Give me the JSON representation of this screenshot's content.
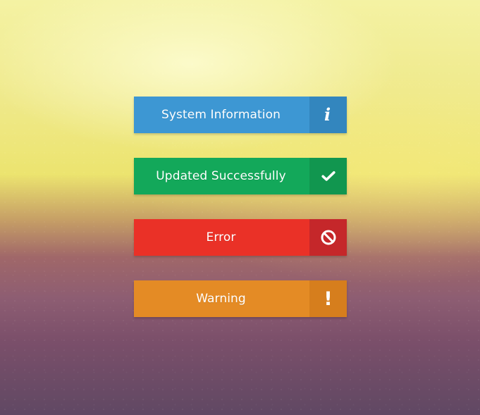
{
  "alerts": [
    {
      "label": "System Information",
      "icon": "info-icon",
      "icon_text": "i",
      "colors": {
        "main": "#3d97d3",
        "icon_bg": "#3386be"
      }
    },
    {
      "label": "Updated Successfully",
      "icon": "checkmark-icon",
      "colors": {
        "main": "#13a85a",
        "icon_bg": "#11964f"
      }
    },
    {
      "label": "Error",
      "icon": "prohibited-icon",
      "colors": {
        "main": "#ea3127",
        "icon_bg": "#c5272a"
      }
    },
    {
      "label": "Warning",
      "icon": "exclamation-icon",
      "icon_text": "!",
      "colors": {
        "main": "#e48b25",
        "icon_bg": "#d67e1d"
      }
    }
  ]
}
